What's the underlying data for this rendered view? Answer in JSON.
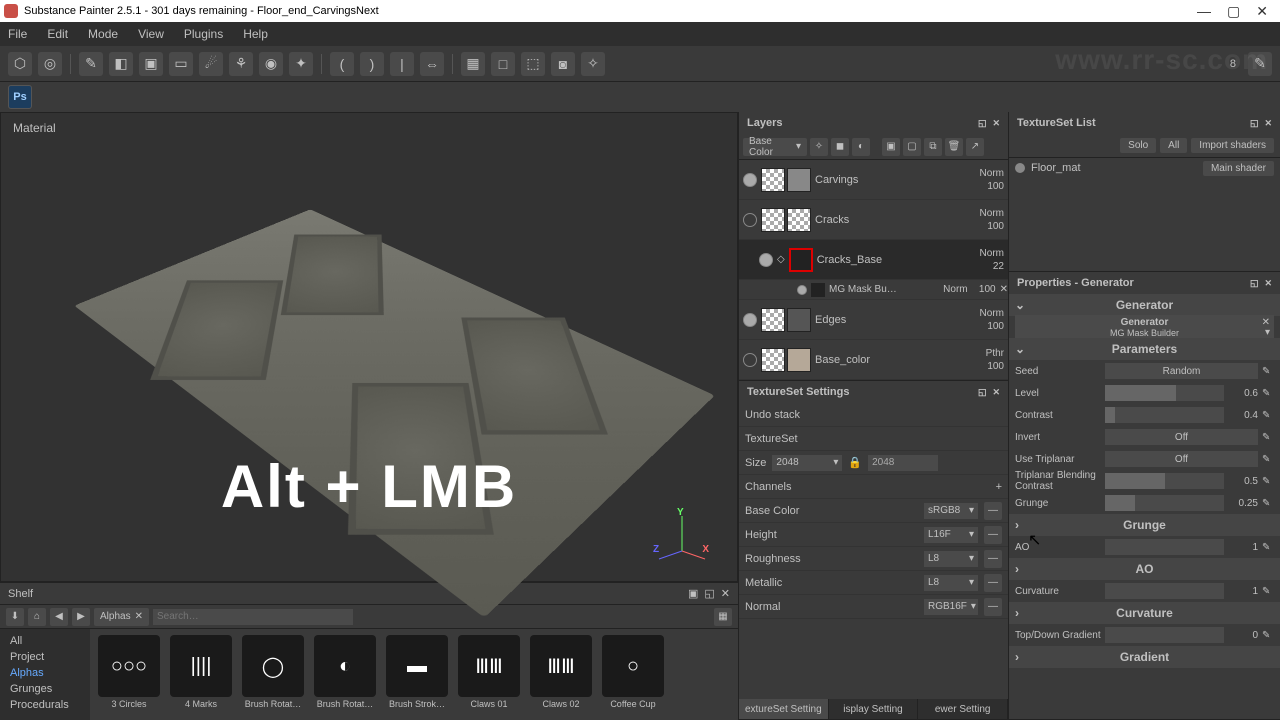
{
  "titlebar": {
    "title": "Substance Painter 2.5.1 - 301 days remaining - Floor_end_CarvingsNext"
  },
  "menubar": [
    "File",
    "Edit",
    "Mode",
    "View",
    "Plugins",
    "Help"
  ],
  "toolbar_value": "8",
  "viewport": {
    "label": "Material",
    "overlay": "Alt + LMB"
  },
  "layers": {
    "title": "Layers",
    "channel": "Base Color",
    "items": [
      {
        "name": "Carvings",
        "mode": "Norm",
        "opacity": "100"
      },
      {
        "name": "Cracks",
        "mode": "Norm",
        "opacity": "100"
      },
      {
        "name": "Cracks_Base",
        "mode": "Norm",
        "opacity": "22"
      },
      {
        "name": "Edges",
        "mode": "Norm",
        "opacity": "100"
      },
      {
        "name": "Base_color",
        "mode": "Pthr",
        "opacity": "100"
      }
    ],
    "subeffect": {
      "name": "MG Mask Bu…",
      "mode": "Norm",
      "opacity": "100"
    }
  },
  "textureset_settings": {
    "title": "TextureSet Settings",
    "rows": [
      "Undo stack",
      "TextureSet"
    ],
    "size_label": "Size",
    "size_value": "2048",
    "size_value2": "2048",
    "channels_label": "Channels",
    "channels": [
      {
        "name": "Base Color",
        "format": "sRGB8"
      },
      {
        "name": "Height",
        "format": "L16F"
      },
      {
        "name": "Roughness",
        "format": "L8"
      },
      {
        "name": "Metallic",
        "format": "L8"
      },
      {
        "name": "Normal",
        "format": "RGB16F"
      }
    ],
    "tabs": [
      "extureSet Setting",
      "isplay Setting",
      "ewer Setting"
    ]
  },
  "textureset_list": {
    "title": "TextureSet List",
    "solo": "Solo",
    "all": "All",
    "import": "Import shaders",
    "items": [
      {
        "name": "Floor_mat",
        "shader": "Main shader"
      }
    ]
  },
  "properties": {
    "title": "Properties - Generator",
    "section": "Generator",
    "generator_label": "Generator",
    "generator_value": "MG Mask Builder",
    "parameters_label": "Parameters",
    "params": [
      {
        "label": "Seed",
        "value": "Random",
        "type": "btn"
      },
      {
        "label": "Level",
        "value": "0.6",
        "type": "slider",
        "fill": 60
      },
      {
        "label": "Contrast",
        "value": "0.4",
        "type": "slider",
        "fill": 8
      },
      {
        "label": "Invert",
        "value": "Off",
        "type": "btn"
      },
      {
        "label": "Use Triplanar",
        "value": "Off",
        "type": "btn"
      },
      {
        "label": "Triplanar Blending Contrast",
        "value": "0.5",
        "type": "slider",
        "fill": 50
      },
      {
        "label": "Grunge",
        "value": "0.25",
        "type": "slider",
        "fill": 25
      }
    ],
    "groups": [
      {
        "header": "Grunge",
        "rows": [
          {
            "label": "AO",
            "value": "1"
          }
        ]
      },
      {
        "header": "AO",
        "rows": [
          {
            "label": "Curvature",
            "value": "1"
          }
        ]
      },
      {
        "header": "Curvature",
        "rows": [
          {
            "label": "Top/Down Gradient",
            "value": "0"
          }
        ]
      },
      {
        "header": "Gradient",
        "rows": []
      }
    ]
  },
  "shelf": {
    "title": "Shelf",
    "tab": "Alphas",
    "search_placeholder": "Search…",
    "categories": [
      "All",
      "Project",
      "Alphas",
      "Grunges",
      "Procedurals"
    ],
    "selected_category": "Alphas",
    "items": [
      "3 Circles",
      "4 Marks",
      "Brush Rotat…",
      "Brush Rotat…",
      "Brush Strok…",
      "Claws 01",
      "Claws 02",
      "Coffee Cup"
    ]
  },
  "watermark": "www.rr-sc.com"
}
